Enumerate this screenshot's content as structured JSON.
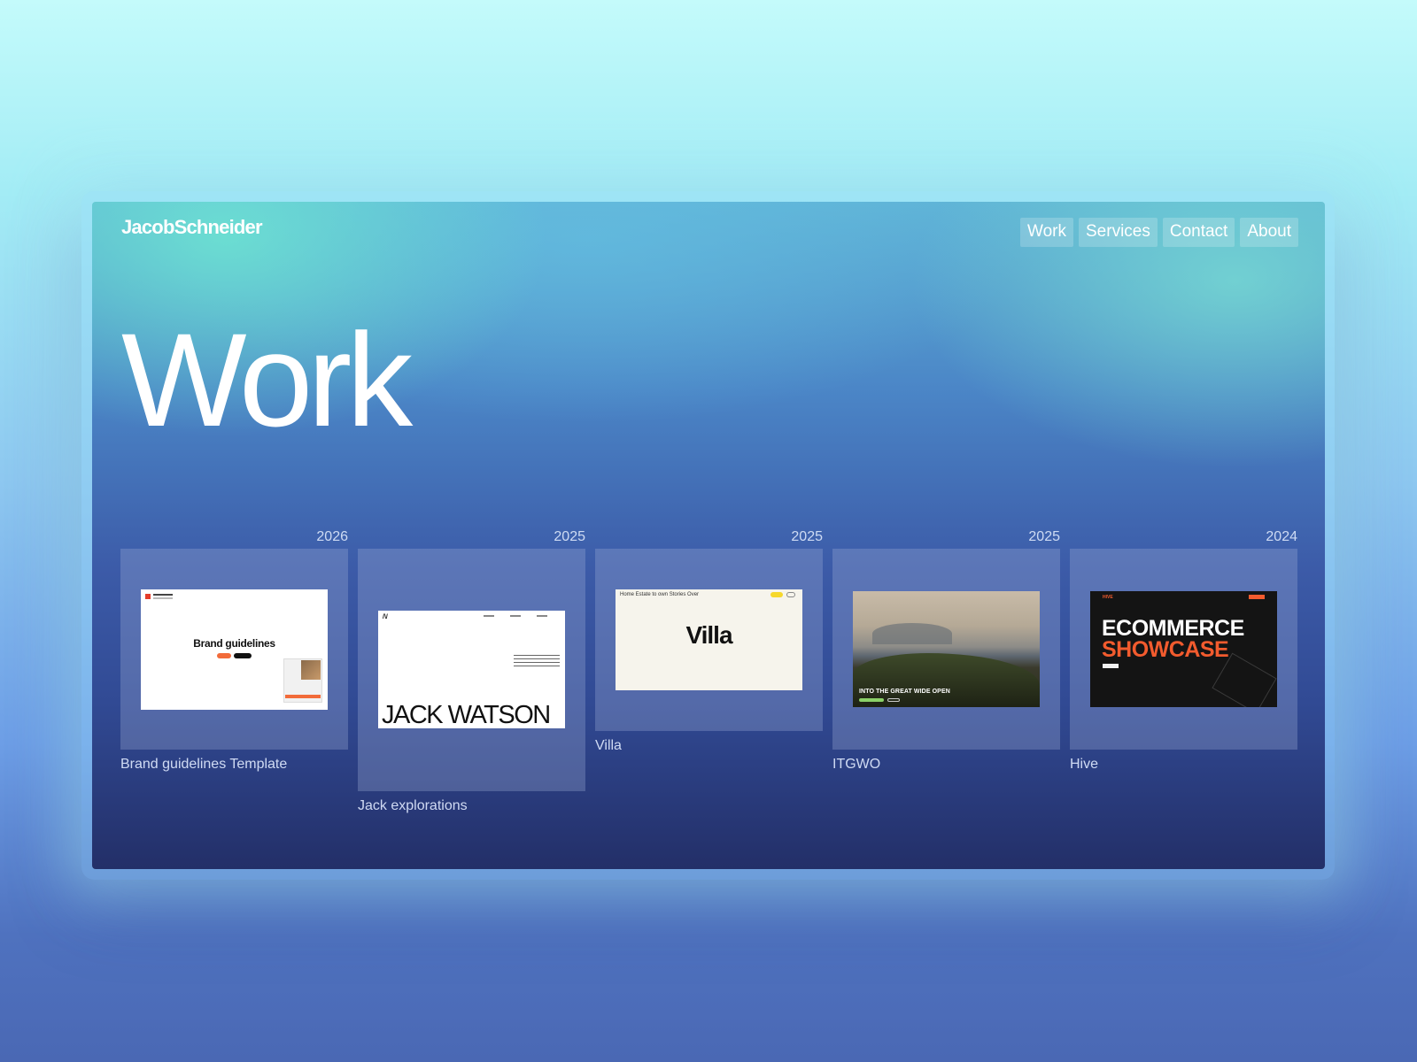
{
  "site": {
    "logo": "JacobSchneider",
    "nav": [
      "Work",
      "Services",
      "Contact",
      "About"
    ]
  },
  "page": {
    "title": "Work"
  },
  "projects": [
    {
      "year": "2026",
      "caption": "Brand guidelines Template",
      "thumb_heading": "Brand guidelines"
    },
    {
      "year": "2025",
      "caption": "Jack explorations",
      "thumb_heading": "JACK WATSON"
    },
    {
      "year": "2025",
      "caption": "Villa",
      "thumb_heading": "Villa",
      "thumb_nav": "Home  Estate to own  Stories  Over"
    },
    {
      "year": "2025",
      "caption": "ITGWO",
      "thumb_heading": "INTO THE GREAT WIDE OPEN"
    },
    {
      "year": "2024",
      "caption": "Hive",
      "thumb_heading_line1": "ECOMMERCE",
      "thumb_heading_line2": "SHOWCASE",
      "thumb_brand": "HIVE"
    }
  ],
  "colors": {
    "accent_orange": "#f25b2e",
    "villa_yellow": "#f6d82c",
    "itgwo_green": "#8bd168"
  }
}
